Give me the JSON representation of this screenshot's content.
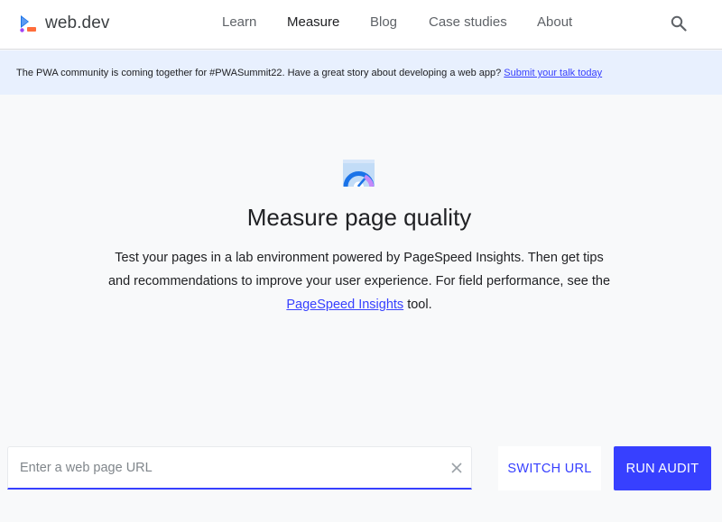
{
  "header": {
    "logo_text": "web.dev",
    "logo_icon": "web-dev-logo-icon",
    "nav": [
      {
        "label": "Learn",
        "active": false
      },
      {
        "label": "Measure",
        "active": true
      },
      {
        "label": "Blog",
        "active": false
      },
      {
        "label": "Case studies",
        "active": false
      },
      {
        "label": "About",
        "active": false
      }
    ],
    "search_icon": "search-icon"
  },
  "banner": {
    "text": "The PWA community is coming together for #PWASummit22. Have a great story about developing a web app? ",
    "link_label": "Submit your talk today"
  },
  "hero": {
    "icon": "speed-gauge-icon",
    "title": "Measure page quality",
    "description_before": "Test your pages in a lab environment powered by PageSpeed Insights. Then get tips and recommendations to improve your user experience. For field performance, see the ",
    "description_link": "PageSpeed Insights",
    "description_after": " tool."
  },
  "audit": {
    "url_value": "",
    "url_placeholder": "Enter a web page URL",
    "clear_icon": "close-icon",
    "switch_label": "SWITCH URL",
    "run_label": "RUN AUDIT"
  },
  "colors": {
    "accent": "#3740ff",
    "banner_bg": "#e8f0fe",
    "page_bg": "#f8f9fa"
  }
}
